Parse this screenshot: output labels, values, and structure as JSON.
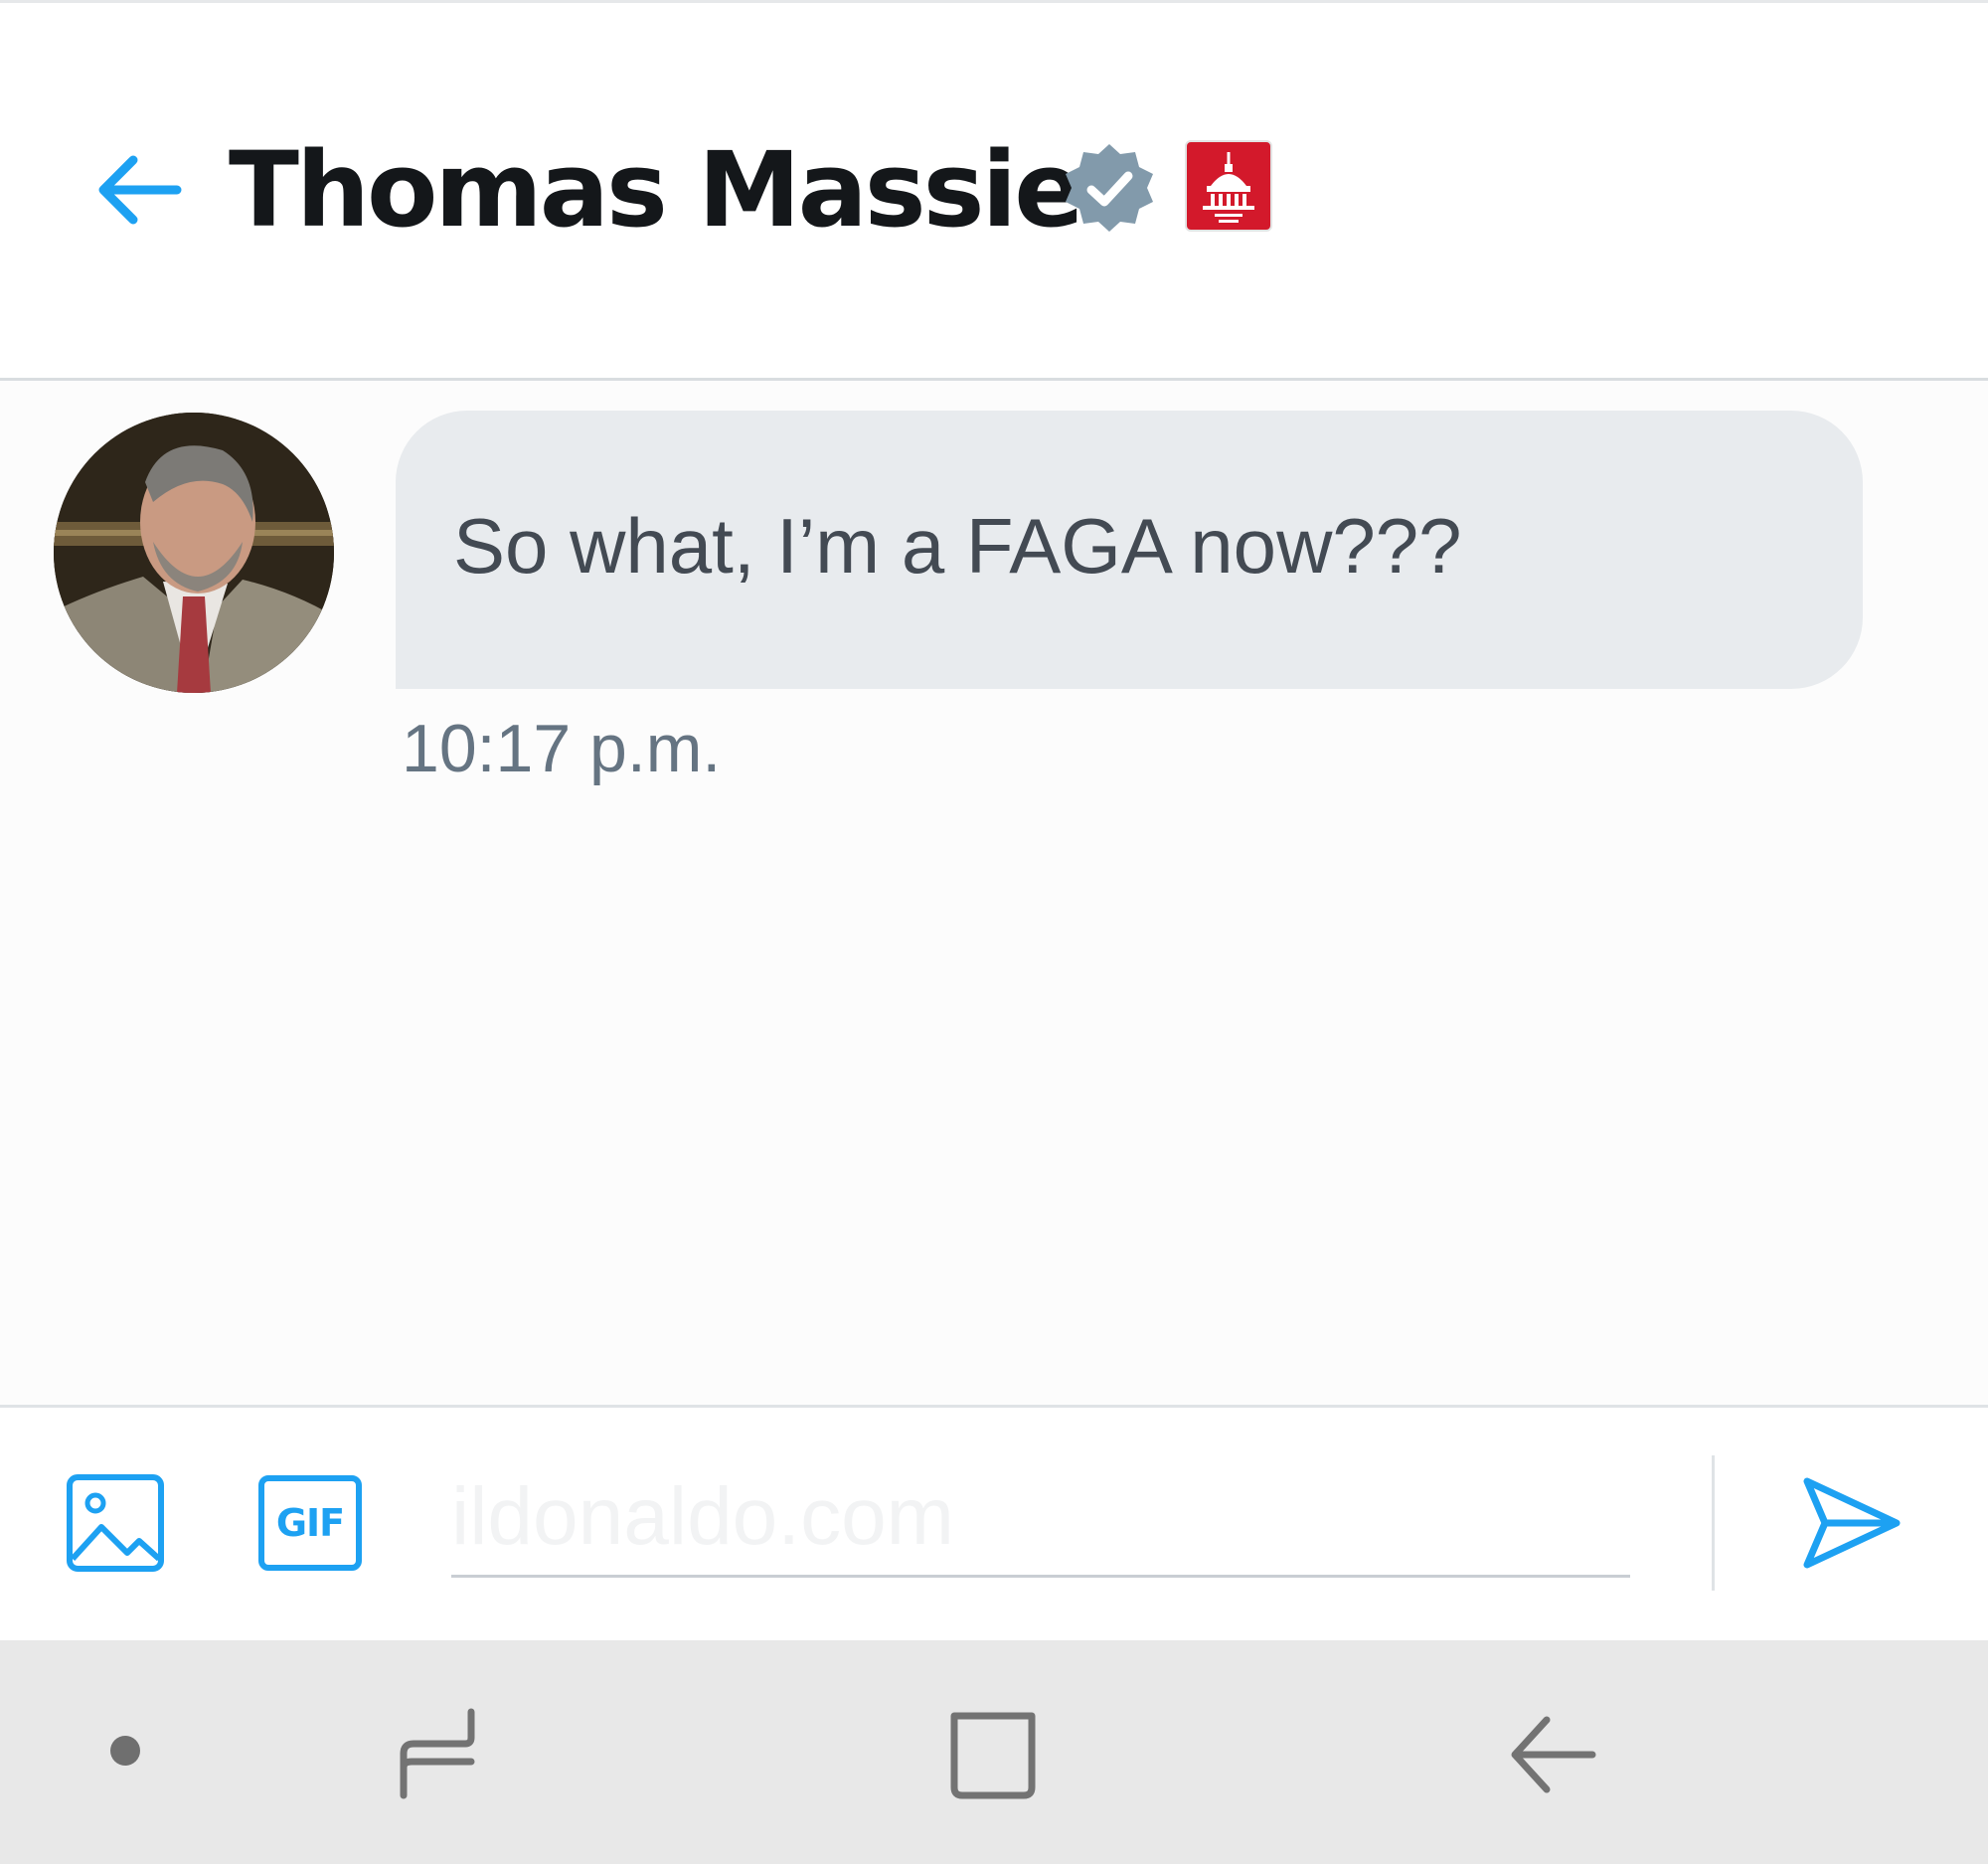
{
  "header": {
    "title": "Thomas Massie",
    "back_icon": "arrow-left-icon",
    "verified_icon": "verified-badge-icon",
    "affiliation_badge": "house-gop-capitol-icon",
    "accent_color": "#1da1f2"
  },
  "conversation": {
    "messages": [
      {
        "text": "So what, I’m a FAGA now???",
        "timestamp": "10:17 p.m."
      }
    ]
  },
  "composer": {
    "media_icon": "image-icon",
    "gif_label": "GIF",
    "input_placeholder": "ildonaldo.com",
    "input_value": "",
    "send_icon": "send-icon"
  },
  "navbar": {
    "items": [
      "dot-indicator",
      "recents-icon",
      "home-icon",
      "back-icon"
    ]
  }
}
